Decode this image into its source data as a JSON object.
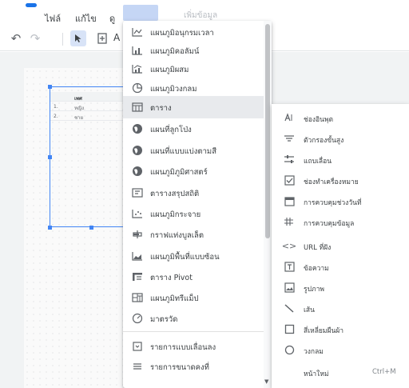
{
  "menubar": {
    "file": "ไฟล์",
    "edit": "แก้ไข",
    "view": "ดู",
    "faded": "เพิ่มข้อมูล"
  },
  "toolbar": {
    "undo_icon": "undo-icon",
    "redo_icon": "redo-icon",
    "select_icon": "cursor-icon",
    "add_page_icon": "add-page-icon",
    "letter": "A"
  },
  "canvas": {
    "table": {
      "header": "เพศ",
      "rows": [
        {
          "num": "1.",
          "value": "หญิง"
        },
        {
          "num": "2.",
          "value": "ชาย"
        }
      ]
    }
  },
  "insert_menu": {
    "items": [
      {
        "icon": "time-series-icon",
        "label": "แผนภูมิอนุกรมเวลา"
      },
      {
        "icon": "bar-chart-icon",
        "label": "แผนภูมิคอลัมน์"
      },
      {
        "icon": "combo-chart-icon",
        "label": "แผนภูมิผสม"
      },
      {
        "icon": "pie-chart-icon",
        "label": "แผนภูมิวงกลม"
      },
      {
        "icon": "table-icon",
        "label": "ตาราง"
      },
      {
        "icon": "globe-icon",
        "label": "แผนที่ลูกโป่ง"
      },
      {
        "icon": "globe-icon",
        "label": "แผนที่แบบแบ่งตามสี"
      },
      {
        "icon": "globe-icon",
        "label": "แผนภูมิภูมิศาสตร์"
      },
      {
        "icon": "scorecard-icon",
        "label": "ตารางสรุปสถิติ"
      },
      {
        "icon": "scatter-icon",
        "label": "แผนภูมิกระจาย"
      },
      {
        "icon": "bullet-chart-icon",
        "label": "กราฟแท่งบูลเล็ต"
      },
      {
        "icon": "area-chart-icon",
        "label": "แผนภูมิพื้นที่แบบซ้อน"
      },
      {
        "icon": "pivot-table-icon",
        "label": "ตาราง Pivot"
      },
      {
        "icon": "treemap-icon",
        "label": "แผนภูมิทรีแม็ป"
      },
      {
        "icon": "gauge-icon",
        "label": "มาตรวัด"
      },
      {
        "icon": "dropdown-list-icon",
        "label": "รายการแบบเลื่อนลง"
      },
      {
        "icon": "fixed-list-icon",
        "label": "รายการขนาดคงที่"
      }
    ]
  },
  "submenu": {
    "items": [
      {
        "icon": "input-box-icon",
        "label": "ช่องอินพุต"
      },
      {
        "icon": "advanced-filter-icon",
        "label": "ตัวกรองขั้นสูง"
      },
      {
        "icon": "slider-icon",
        "label": "แถบเลื่อน"
      },
      {
        "icon": "checkbox-icon",
        "label": "ช่องทำเครื่องหมาย"
      },
      {
        "icon": "calendar-icon",
        "label": "การควบคุมช่วงวันที่"
      },
      {
        "icon": "data-control-icon",
        "label": "การควบคุมข้อมูล"
      },
      {
        "icon": "code-icon",
        "label": "URL ที่ฝัง"
      },
      {
        "icon": "text-icon",
        "label": "ข้อความ"
      },
      {
        "icon": "image-icon",
        "label": "รูปภาพ"
      },
      {
        "icon": "line-icon",
        "label": "เส้น"
      },
      {
        "icon": "rectangle-icon",
        "label": "สี่เหลี่ยมผืนผ้า"
      },
      {
        "icon": "circle-icon",
        "label": "วงกลม"
      },
      {
        "icon": "",
        "label": "หน้าใหม่",
        "shortcut": "Ctrl+M"
      }
    ]
  }
}
